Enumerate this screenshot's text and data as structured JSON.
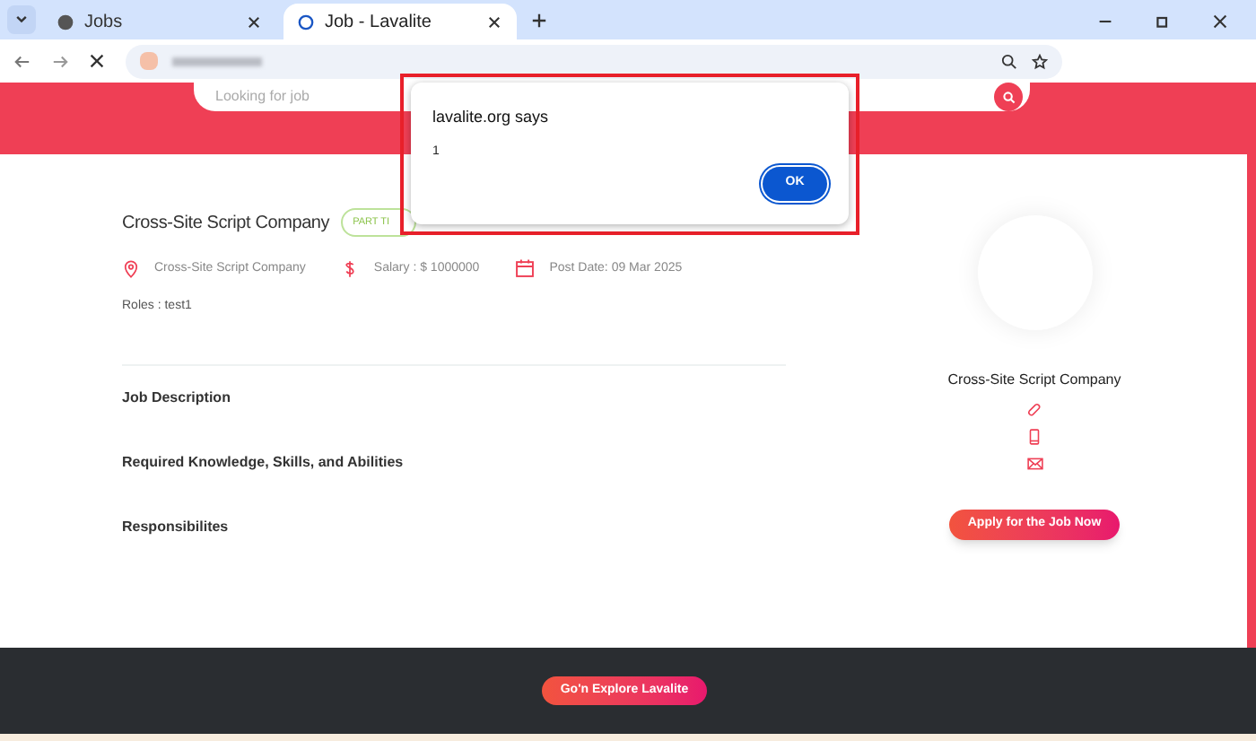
{
  "browser": {
    "tabs": [
      {
        "label": "Jobs",
        "selected": false
      },
      {
        "label": "Job - Lavalite",
        "selected": true
      }
    ]
  },
  "header": {
    "search": {
      "placeholder": "Looking for job"
    }
  },
  "job": {
    "title": "Cross-Site Script Company",
    "badge": "PART TI",
    "company": "Cross-Site Script Company",
    "salary": "Salary : $ 1000000",
    "post_date": "Post Date: 09 Mar 2025",
    "roles": "Roles : test1",
    "sections": [
      "Job Description",
      "Required Knowledge, Skills, and Abilities",
      "Responsibilites"
    ]
  },
  "company_card": {
    "name": "Cross-Site Script Company",
    "apply_button": "Apply for the Job Now"
  },
  "footer": {
    "button": "Go'n Explore Lavalite"
  },
  "dialog": {
    "title": "lavalite.org says",
    "message": "1",
    "ok_button": "OK"
  }
}
